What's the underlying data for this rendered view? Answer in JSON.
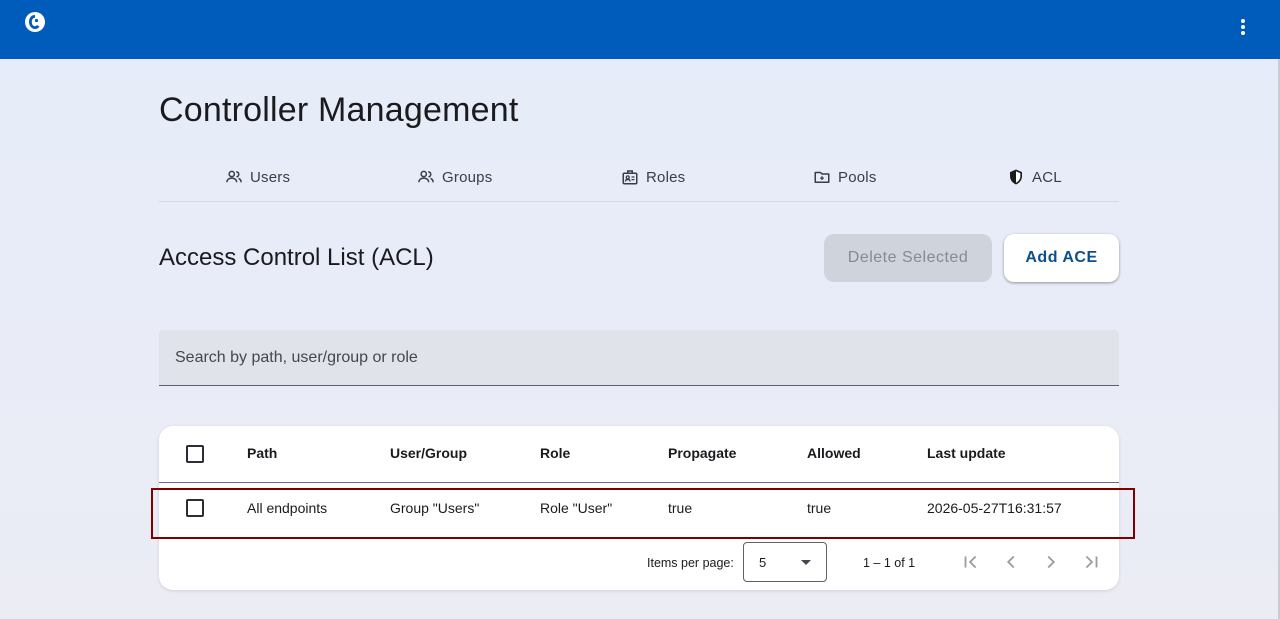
{
  "colors": {
    "topbar": "#005cbb",
    "add_button_text": "#0b4f8f",
    "highlight": "#800000"
  },
  "topbar": {
    "logo_icon": "app-logo-icon",
    "menu_icon": "more-vert-icon"
  },
  "page": {
    "title": "Controller Management"
  },
  "tabs": [
    {
      "label": "Users",
      "icon": "users-icon"
    },
    {
      "label": "Groups",
      "icon": "groups-icon"
    },
    {
      "label": "Roles",
      "icon": "roles-icon"
    },
    {
      "label": "Pools",
      "icon": "pools-icon"
    },
    {
      "label": "ACL",
      "icon": "shield-icon"
    }
  ],
  "section": {
    "title": "Access Control List (ACL)",
    "delete_label": "Delete Selected",
    "add_label": "Add ACE"
  },
  "search": {
    "placeholder": "Search by path, user/group or role",
    "value": ""
  },
  "table": {
    "columns": [
      "Path",
      "User/Group",
      "Role",
      "Propagate",
      "Allowed",
      "Last update"
    ],
    "rows": [
      {
        "path": "All endpoints",
        "user_group": "Group \"Users\"",
        "role": "Role \"User\"",
        "propagate": "true",
        "allowed": "true",
        "last_update": "2026-05-27T16:31:57"
      }
    ]
  },
  "paginator": {
    "items_per_page_label": "Items per page:",
    "items_per_page": "5",
    "range": "1 – 1 of 1"
  }
}
